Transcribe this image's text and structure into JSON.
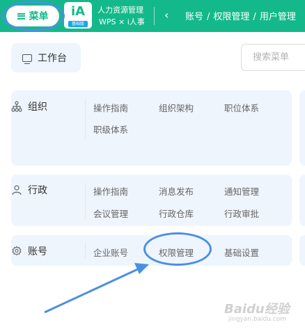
{
  "topbar": {
    "menu_label": "菜单",
    "logo_text": "iA",
    "logo_badge": "基础版",
    "brand_line1": "人力资源管理",
    "brand_line2": "WPS × i人事",
    "back_icon": "chevron-left-icon",
    "breadcrumb": [
      "账号",
      "权限管理",
      "用户管理"
    ],
    "accent_color": "#13b98a"
  },
  "workbench": {
    "label": "工作台",
    "icon": "monitor-icon"
  },
  "search": {
    "placeholder": "搜索菜单"
  },
  "sections": [
    {
      "title": "组织",
      "icon": "org-tree-icon",
      "links": [
        "操作指南",
        "组织架构",
        "职位体系",
        "职级体系"
      ]
    },
    {
      "title": "行政",
      "icon": "person-icon",
      "links": [
        "操作指南",
        "消息发布",
        "通知管理",
        "会议管理",
        "行政仓库",
        "行政审批"
      ]
    },
    {
      "title": "账号",
      "icon": "gear-icon",
      "links": [
        "企业账号",
        "权限管理",
        "基础设置"
      ]
    }
  ],
  "annotation": {
    "highlight_color": "#4a90e2"
  },
  "watermark": {
    "brand": "Baidu经验",
    "url": "jingyan.baidu.com"
  }
}
